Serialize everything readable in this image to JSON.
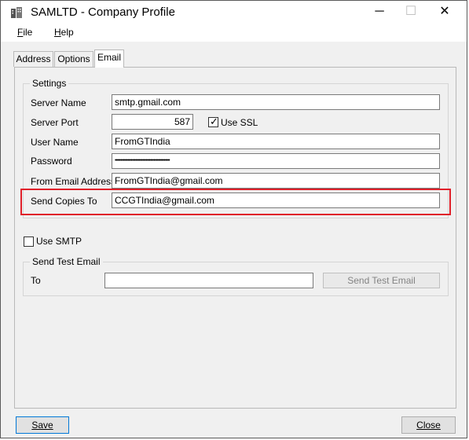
{
  "window": {
    "title": "SAMLTD - Company Profile",
    "minimize_glyph": "─",
    "maximize_glyph": "☐",
    "close_glyph": "✕"
  },
  "menu": {
    "file": {
      "mnemonic": "F",
      "rest": "ile"
    },
    "help": {
      "mnemonic": "H",
      "rest": "elp"
    }
  },
  "tabs": [
    {
      "label": "Address",
      "active": false
    },
    {
      "label": "Options",
      "active": false
    },
    {
      "label": "Email",
      "active": true
    }
  ],
  "settings": {
    "title": "Settings",
    "server_name": {
      "label": "Server Name",
      "value": "smtp.gmail.com"
    },
    "server_port": {
      "label": "Server Port",
      "value": "587"
    },
    "use_ssl": {
      "label": "Use SSL",
      "checked": true
    },
    "user_name": {
      "label": "User Name",
      "value": "FromGTIndia"
    },
    "password": {
      "label": "Password",
      "value": "••••••••••••••••••••••••••••••••••••••••••••••••"
    },
    "from_email": {
      "label": "From Email Address",
      "value": "FromGTIndia@gmail.com"
    },
    "send_copies": {
      "label": "Send Copies To",
      "value": "CCGTIndia@gmail.com"
    }
  },
  "use_smtp": {
    "label": "Use SMTP",
    "checked": false
  },
  "test_email": {
    "title": "Send Test Email",
    "to_label": "To",
    "to_value": "",
    "button_label": "Send Test Email"
  },
  "footer": {
    "save_label": "Save",
    "close_label": "Close"
  },
  "colors": {
    "highlight": "#e0202a",
    "focus_border": "#0078d7"
  }
}
